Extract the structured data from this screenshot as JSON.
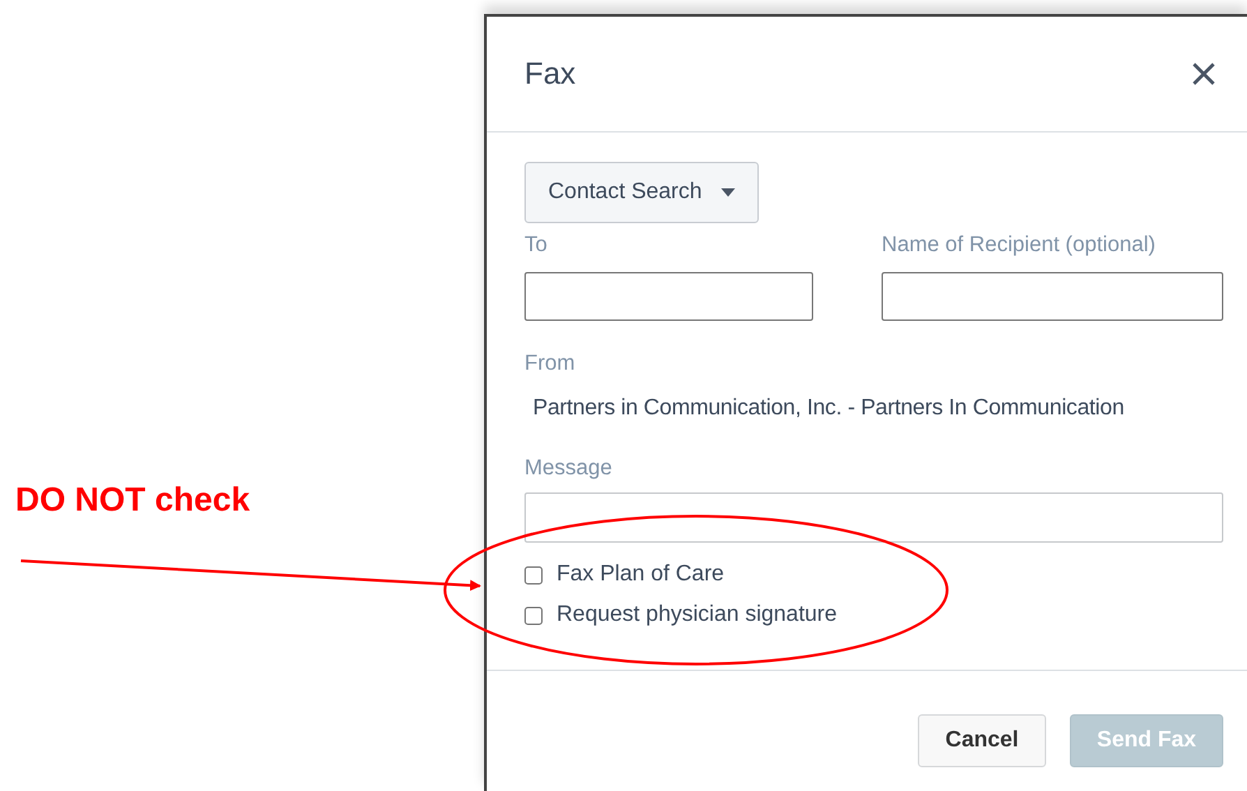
{
  "annotation": {
    "text": "DO NOT check"
  },
  "dialog": {
    "title": "Fax",
    "contact_search": {
      "label": "Contact Search"
    },
    "fields": [
      {
        "label": "To"
      },
      {
        "label": "Name of Recipient (optional)"
      }
    ],
    "from": {
      "label": "From",
      "value": "Partners in Communication, Inc. - Partners In Communication"
    },
    "message": {
      "label": "Message"
    },
    "checkboxes": [
      {
        "label": "Fax Plan of Care",
        "checked": false
      },
      {
        "label": "Request physician signature",
        "checked": false
      }
    ],
    "buttons": [
      {
        "label": "Cancel",
        "kind": "secondary",
        "disabled": false
      },
      {
        "label": "Send Fax",
        "kind": "primary",
        "disabled": true
      }
    ]
  }
}
